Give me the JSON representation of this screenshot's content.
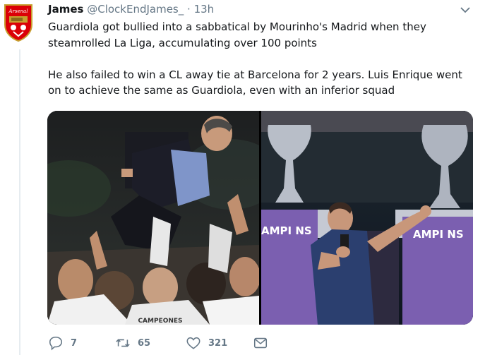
{
  "tweet": {
    "author_name": "James",
    "author_handle": "@ClockEndJames_",
    "separator": "·",
    "time": "13h",
    "avatar_text": "Arsenal",
    "text": "Guardiola got bullied into a sabbatical by Mourinho's Madrid when they steamrolled La Liga, accumulating over 100 points\n\nHe also failed to win a CL away tie at Barcelona for 2 years. Luis Enrique went on to achieve the same as Guardiola, even with an inferior squad"
  },
  "media": {
    "left_photo_text": "CAMPEONES",
    "right_photo_text_1": "AMPI  NS",
    "right_photo_text_2": "AMPI  NS"
  },
  "actions": {
    "reply_count": "7",
    "retweet_count": "65",
    "like_count": "321"
  },
  "colors": {
    "text": "#14171a",
    "secondary": "#657786",
    "border": "#e6ecf0",
    "arsenal_red": "#db0007"
  },
  "icons": [
    "reply-icon",
    "retweet-icon",
    "like-icon",
    "message-icon",
    "chevron-down-icon"
  ]
}
